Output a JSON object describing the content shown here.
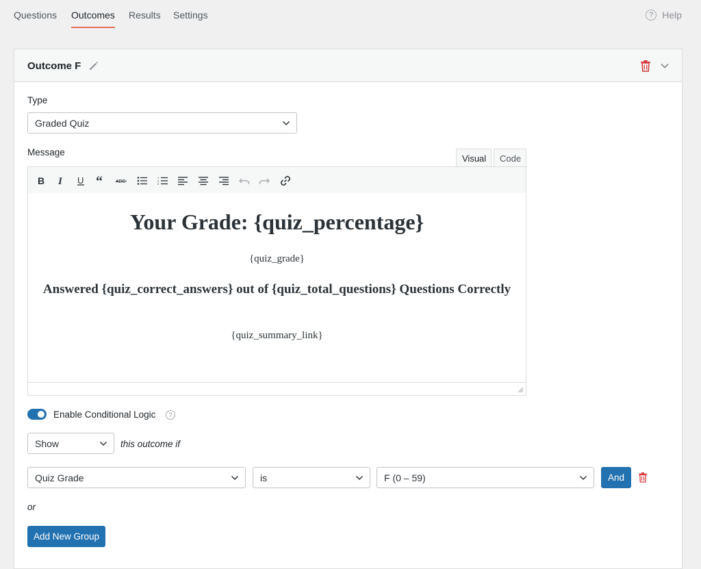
{
  "nav": {
    "tabs": [
      {
        "label": "Questions"
      },
      {
        "label": "Outcomes"
      },
      {
        "label": "Results"
      },
      {
        "label": "Settings"
      }
    ],
    "active_tab": "Outcomes",
    "help_label": "Help"
  },
  "outcome": {
    "title": "Outcome F",
    "type_label": "Type",
    "type_value": "Graded Quiz",
    "message_label": "Message",
    "editor_tabs": {
      "visual": "Visual",
      "code": "Code"
    },
    "content": {
      "heading": "Your Grade: {quiz_percentage}",
      "grade_tag": "{quiz_grade}",
      "answered_line": "Answered {quiz_correct_answers} out of {quiz_total_questions} Questions Correctly",
      "summary_tag": "{quiz_summary_link}"
    },
    "conditional_logic": {
      "toggle_label": "Enable Conditional Logic",
      "enabled": true,
      "action_value": "Show",
      "action_suffix": "this outcome if",
      "rule": {
        "field": "Quiz Grade",
        "operator": "is",
        "value": "F (0 – 59)"
      },
      "and_label": "And",
      "or_label": "or",
      "add_group_label": "Add New Group"
    }
  },
  "colors": {
    "accent": "#2271b1",
    "active_tab_underline": "#e26f56",
    "delete": "#d63638"
  }
}
